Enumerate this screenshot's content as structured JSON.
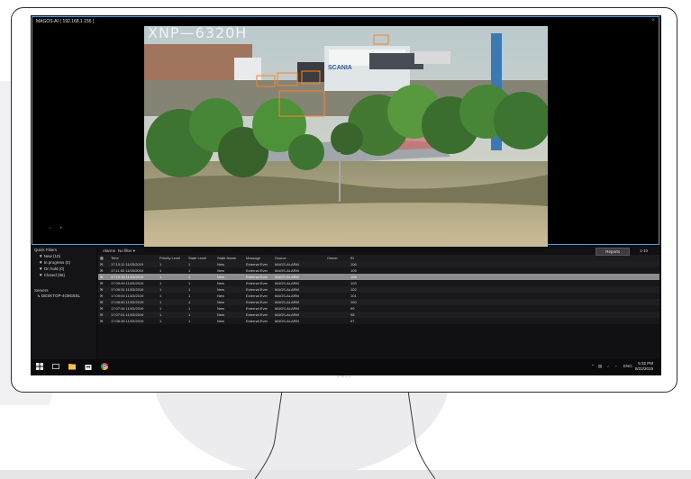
{
  "monitor": {
    "brand": "DELL"
  },
  "viewer": {
    "camera_title": "MAGOS-AI ( 192.168.1.156 )",
    "video_overlay": "XNP—6320H",
    "truck_label": "SCANIA",
    "nav_prev": "−",
    "nav_next": "+",
    "close": "×"
  },
  "quick_filters": {
    "title": "Quick Filters",
    "items": [
      {
        "label": "New (10)"
      },
      {
        "label": "In progress (0)"
      },
      {
        "label": "On hold (0)"
      },
      {
        "label": "Closed (96)"
      }
    ]
  },
  "servers": {
    "title": "Servers",
    "items": [
      {
        "label": "DESKTOP-4O8G5SL"
      }
    ]
  },
  "alarms": {
    "tab_label": "Alarms",
    "filter_label": "No filter",
    "reports_button": "Reports",
    "page_info": "1-10",
    "columns": [
      "Time",
      "Priority Level",
      "State Level",
      "State Name",
      "Message",
      "Source",
      "Owner",
      "ID"
    ],
    "rows": [
      {
        "time": "17:13:11 11/03/2019",
        "priority": "1",
        "state_level": "1",
        "state_name": "New",
        "message": "External Ever",
        "source": "MAGS-ALARM",
        "owner": "",
        "id": "106"
      },
      {
        "time": "17:11:53 11/03/2019",
        "priority": "1",
        "state_level": "1",
        "state_name": "New",
        "message": "External Ever",
        "source": "MAGS-ALARM",
        "owner": "",
        "id": "105"
      },
      {
        "time": "17:10:15 11/03/2019",
        "priority": "1",
        "state_level": "1",
        "state_name": "New",
        "message": "External Ever",
        "source": "MAGS-ALARM",
        "owner": "",
        "id": "104"
      },
      {
        "time": "17:09:49 11/03/2019",
        "priority": "1",
        "state_level": "1",
        "state_name": "New",
        "message": "External Ever",
        "source": "MAGS-ALARM",
        "owner": "",
        "id": "103"
      },
      {
        "time": "17:09:31 11/03/2019",
        "priority": "1",
        "state_level": "1",
        "state_name": "New",
        "message": "External Ever",
        "source": "MAGS-ALARM",
        "owner": "",
        "id": "102"
      },
      {
        "time": "17:09:04 11/03/2019",
        "priority": "1",
        "state_level": "1",
        "state_name": "New",
        "message": "External Ever",
        "source": "MAGS-ALARM",
        "owner": "",
        "id": "101"
      },
      {
        "time": "17:08:50 11/03/2019",
        "priority": "1",
        "state_level": "1",
        "state_name": "New",
        "message": "External Ever",
        "source": "MAGS-ALARM",
        "owner": "",
        "id": "100"
      },
      {
        "time": "17:07:34 11/03/2019",
        "priority": "1",
        "state_level": "1",
        "state_name": "New",
        "message": "External Ever",
        "source": "MAGS-ALARM",
        "owner": "",
        "id": "99"
      },
      {
        "time": "17:07:01 11/03/2019",
        "priority": "1",
        "state_level": "1",
        "state_name": "New",
        "message": "External Ever",
        "source": "MAGS-ALARM",
        "owner": "",
        "id": "98"
      },
      {
        "time": "17:06:36 11/03/2019",
        "priority": "1",
        "state_level": "1",
        "state_name": "New",
        "message": "External Ever",
        "source": "MAGS-ALARM",
        "owner": "",
        "id": "97"
      }
    ],
    "selected_row": 2
  },
  "taskbar": {
    "tray_lang": "ENG",
    "clock_time": "5:32 PM",
    "clock_date": "8/22/2019",
    "icons": [
      "windows-start-icon",
      "task-view-icon",
      "file-explorer-icon",
      "store-icon",
      "chrome-icon"
    ]
  },
  "colors": {
    "accent_border": "#4aa3df",
    "selected_row": "#8b8b8f",
    "detection_box": "#ff7a1a"
  }
}
